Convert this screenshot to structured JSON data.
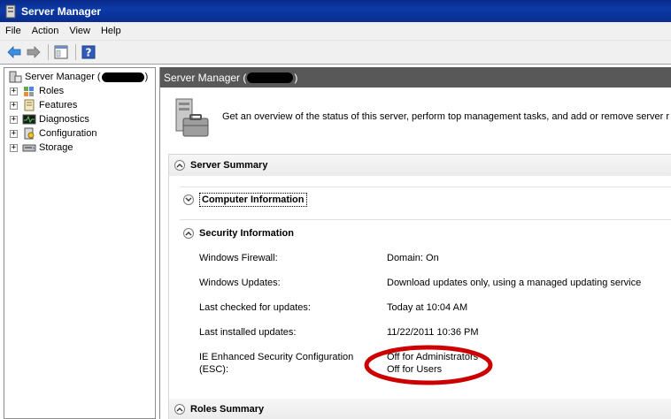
{
  "window": {
    "title": "Server Manager"
  },
  "menu": {
    "file": "File",
    "action": "Action",
    "view": "View",
    "help": "Help"
  },
  "tree": {
    "root_label": "Server Manager (",
    "root_label_end": ")",
    "items": [
      {
        "label": "Roles"
      },
      {
        "label": "Features"
      },
      {
        "label": "Diagnostics"
      },
      {
        "label": "Configuration"
      },
      {
        "label": "Storage"
      }
    ]
  },
  "content": {
    "header_prefix": "Server Manager (",
    "header_suffix": ")",
    "overview_text": "Get an overview of the status of this server, perform top management tasks, and add or remove server r",
    "server_summary": "Server Summary",
    "computer_info": "Computer Information",
    "security_info": "Security Information",
    "roles_summary": "Roles Summary",
    "rows": [
      {
        "label": "Windows Firewall:",
        "value": "Domain: On"
      },
      {
        "label": "Windows Updates:",
        "value": "Download updates only, using a managed updating service"
      },
      {
        "label": "Last checked for updates:",
        "value": "Today at 10:04 AM"
      },
      {
        "label": "Last installed updates:",
        "value": "11/22/2011 10:36 PM"
      },
      {
        "label": "IE Enhanced Security Configuration",
        "label2": "(ESC):",
        "value": "Off for Administrators",
        "value2": "Off for Users"
      }
    ]
  },
  "colors": {
    "title_bar": "#0b3aa8",
    "content_header": "#585858",
    "highlight_ellipse": "#cc0000"
  }
}
